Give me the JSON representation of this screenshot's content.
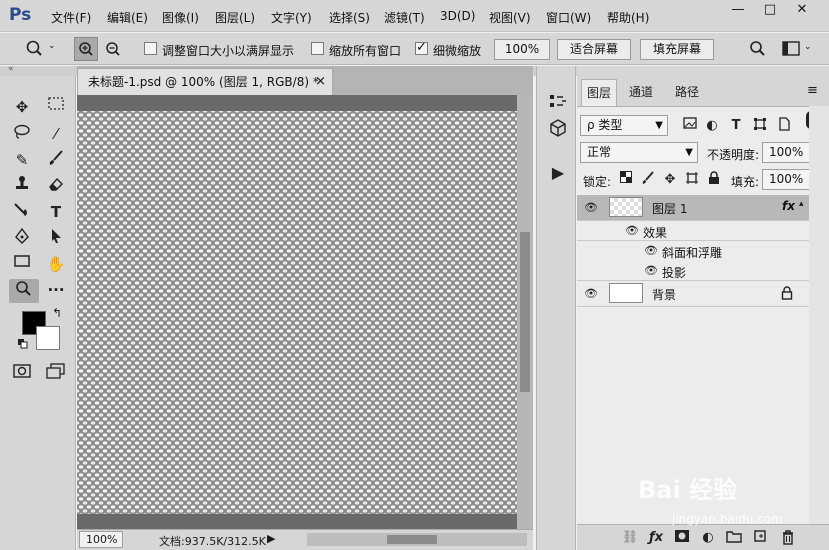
{
  "app": {
    "logo": "Ps"
  },
  "menu": [
    "文件(F)",
    "编辑(E)",
    "图像(I)",
    "图层(L)",
    "文字(Y)",
    "选择(S)",
    "滤镜(T)",
    "3D(D)",
    "视图(V)",
    "窗口(W)",
    "帮助(H)"
  ],
  "window_controls": {
    "minimize": "—",
    "maximize": "□",
    "close": "✕"
  },
  "options": {
    "resize_windows": {
      "label": "调整窗口大小以满屏显示",
      "checked": false
    },
    "zoom_all": {
      "label": "缩放所有窗口",
      "checked": false
    },
    "scrubby_zoom": {
      "label": "细微缩放",
      "checked": true
    },
    "zoom_value": "100%",
    "fit_screen": "适合屏幕",
    "fill_screen": "填充屏幕"
  },
  "document": {
    "tab_title": "未标题-1.psd @ 100% (图层 1, RGB/8) *",
    "close": "×",
    "zoom": "100%",
    "info": "文档:937.5K/312.5K",
    "info_arrow": "▶"
  },
  "layers_panel": {
    "tabs": [
      "图层",
      "通道",
      "路径"
    ],
    "filter_kind": "ρ 类型",
    "blend_mode": "正常",
    "opacity_label": "不透明度:",
    "opacity_value": "100%",
    "lock_label": "锁定:",
    "fill_label": "填充:",
    "fill_value": "100%",
    "layers": [
      {
        "name": "图层 1",
        "fx": "fx"
      },
      {
        "name": "背景"
      }
    ],
    "effects_label": "效果",
    "effects": [
      "斜面和浮雕",
      "投影"
    ]
  },
  "watermark": {
    "brand": "Bai 经验",
    "url": "jingyan.baidu.com"
  }
}
